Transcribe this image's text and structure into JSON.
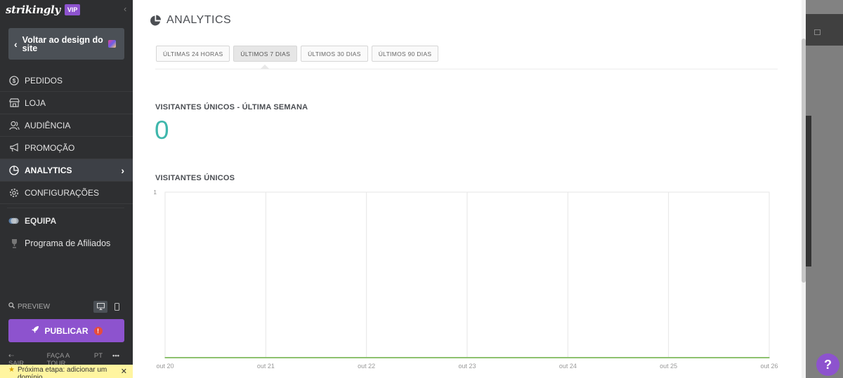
{
  "brand": {
    "logo": "strikingly",
    "badge": "VIP",
    "collapse_icon": "chevron-left"
  },
  "sidebar": {
    "back_label": "Voltar ao design do site",
    "items": [
      {
        "label": "PEDIDOS",
        "icon": "dollar-circle"
      },
      {
        "label": "LOJA",
        "icon": "store"
      },
      {
        "label": "AUDIÊNCIA",
        "icon": "users"
      },
      {
        "label": "PROMOÇÃO",
        "icon": "megaphone"
      },
      {
        "label": "ANALYTICS",
        "icon": "pie-chart",
        "active": true
      },
      {
        "label": "CONFIGURAÇÕES",
        "icon": "gear"
      },
      {
        "label": "EQUIPA",
        "icon": "team"
      },
      {
        "label": "Programa de Afiliados",
        "icon": "trophy"
      }
    ],
    "preview_label": "PREVIEW",
    "publish_label": "PUBLICAR",
    "footer": {
      "exit": "SAIR",
      "tour": "FAÇA A TOUR",
      "lang": "PT",
      "more": "•••"
    },
    "next_step": "Próxima etapa: adicionar um domínio"
  },
  "main": {
    "title": "ANALYTICS",
    "tabs": [
      {
        "label": "ÚLTIMAS 24 HORAS"
      },
      {
        "label": "ÚLTIMOS 7 DIAS",
        "active": true
      },
      {
        "label": "ÚLTIMOS 30 DIAS"
      },
      {
        "label": "ÚLTIMOS 90 DIAS"
      }
    ],
    "unique_week_title": "VISITANTES ÚNICOS - ÚLTIMA SEMANA",
    "unique_week_value": "0",
    "chart_title": "VISITANTES ÚNICOS"
  },
  "colors": {
    "sidebar_bg": "#2e2f31",
    "accent_purple": "#8d53ce",
    "value_teal": "#3fb7ac",
    "series_green": "#8dc26f"
  },
  "chart_data": {
    "type": "line",
    "title": "VISITANTES ÚNICOS",
    "x": [
      "out 20",
      "out 21",
      "out 22",
      "out 23",
      "out 24",
      "out 25",
      "out 26"
    ],
    "series": [
      {
        "values": [
          0,
          0,
          0,
          0,
          0,
          0,
          0
        ]
      }
    ],
    "ylim": [
      0,
      1
    ],
    "yticks": [
      "1"
    ],
    "grid": true
  },
  "help_label": "?"
}
